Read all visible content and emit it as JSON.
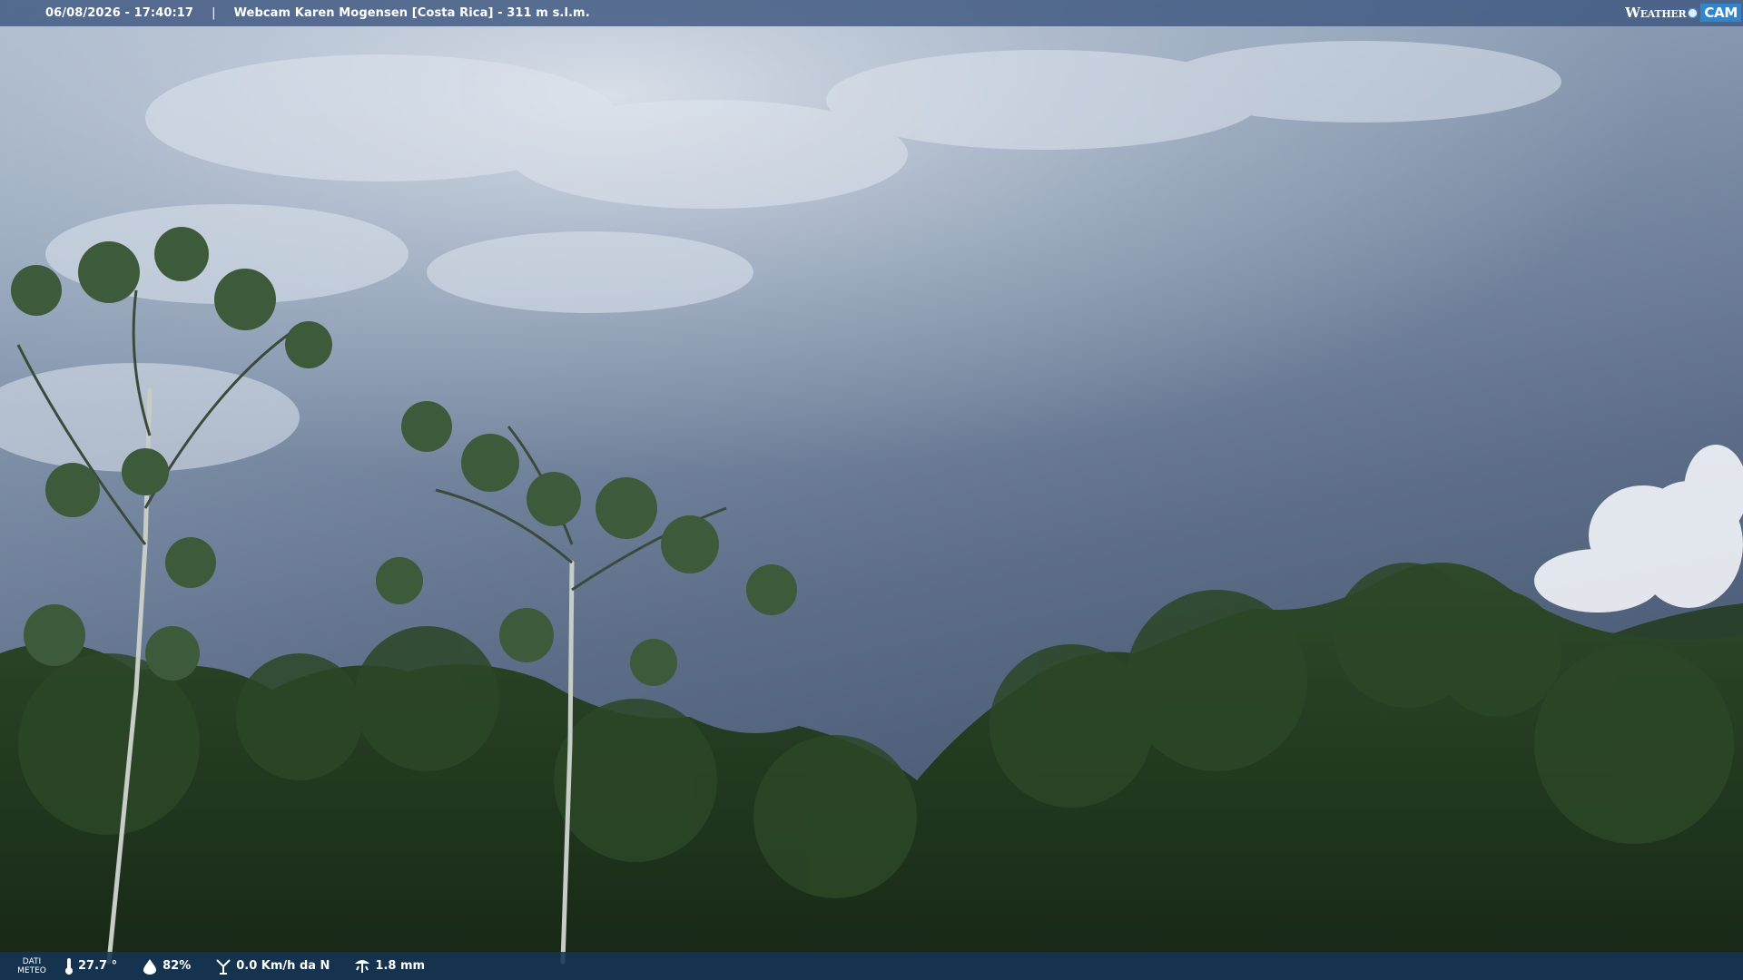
{
  "header": {
    "datetime": "06/08/2026 - 17:40:17",
    "separator": "|",
    "station": "Webcam Karen Mogensen [Costa Rica] - 311 m s.l.m."
  },
  "logo": {
    "weather_text": "Weather",
    "cam_text": "CAM"
  },
  "footer": {
    "dati_line1": "DATI",
    "dati_line2": "METEO",
    "temperature": "27.7 °",
    "humidity": "82%",
    "wind": "0.0 Km/h da N",
    "rain": "1.8 mm"
  },
  "icons": {
    "temperature": "thermometer-icon",
    "humidity": "humidity-drop-icon",
    "wind": "wind-vane-icon",
    "rain": "rain-gauge-icon"
  },
  "colors": {
    "topbar": "#3e5880",
    "bottombar": "#163456",
    "logo_accent": "#2f86cf",
    "sky": "#5e6f88",
    "foliage": "#22361f"
  }
}
